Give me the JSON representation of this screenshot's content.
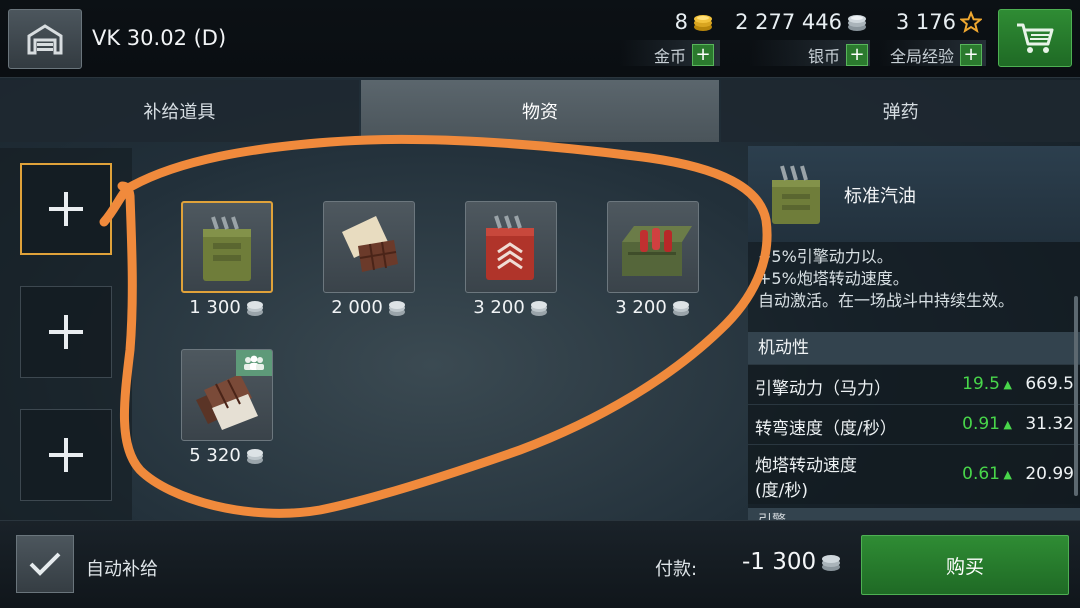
{
  "header": {
    "vehicle_name": "VK 30.02 (D)",
    "gold": {
      "amount": "8",
      "label": "金币"
    },
    "silver": {
      "amount": "2 277 446",
      "label": "银币"
    },
    "free_xp": {
      "amount": "3 176",
      "label": "全局经验"
    },
    "plus_symbol": "+"
  },
  "tabs": [
    {
      "label": "补给道具",
      "active": false
    },
    {
      "label": "物资",
      "active": true
    },
    {
      "label": "弹药",
      "active": false
    }
  ],
  "slots": [
    {
      "symbol": "+",
      "selected": true
    },
    {
      "symbol": "+",
      "selected": false
    },
    {
      "symbol": "+",
      "selected": false
    }
  ],
  "items": [
    {
      "icon": "standard-fuel-icon",
      "price": "1 300",
      "selected": true
    },
    {
      "icon": "chocolate-icon",
      "price": "2 000",
      "selected": false
    },
    {
      "icon": "enhanced-fuel-icon",
      "price": "3 200",
      "selected": false
    },
    {
      "icon": "cola-crate-icon",
      "price": "3 200",
      "selected": false
    },
    {
      "icon": "chocolate-bars-icon",
      "price": "5 320",
      "selected": false,
      "crew_badge": true
    }
  ],
  "details": {
    "title": "标准汽油",
    "effects": [
      "+5%引擎动力以。",
      "+5%炮塔转动速度。",
      "自动激活。在一场战斗中持续生效。"
    ],
    "section": "机动性",
    "stats": [
      {
        "name": "引擎动力（马力）",
        "bonus": "19.5",
        "total": "669.5"
      },
      {
        "name": "转弯速度（度/秒）",
        "bonus": "0.91",
        "total": "31.32"
      },
      {
        "name_line1": "炮塔转动速度",
        "name_line2": "(度/秒)",
        "bonus": "0.61",
        "total": "20.99"
      }
    ],
    "next_section": "引擎"
  },
  "footer": {
    "auto_resupply_label": "自动补给",
    "pay_label": "付款:",
    "pay_amount": "-1 300",
    "buy_label": "购买"
  },
  "colors": {
    "accent_orange": "#e0a23a",
    "annotation_orange": "#f08a3c",
    "buy_green": "#2f8c34",
    "bonus_green": "#48d64a"
  }
}
